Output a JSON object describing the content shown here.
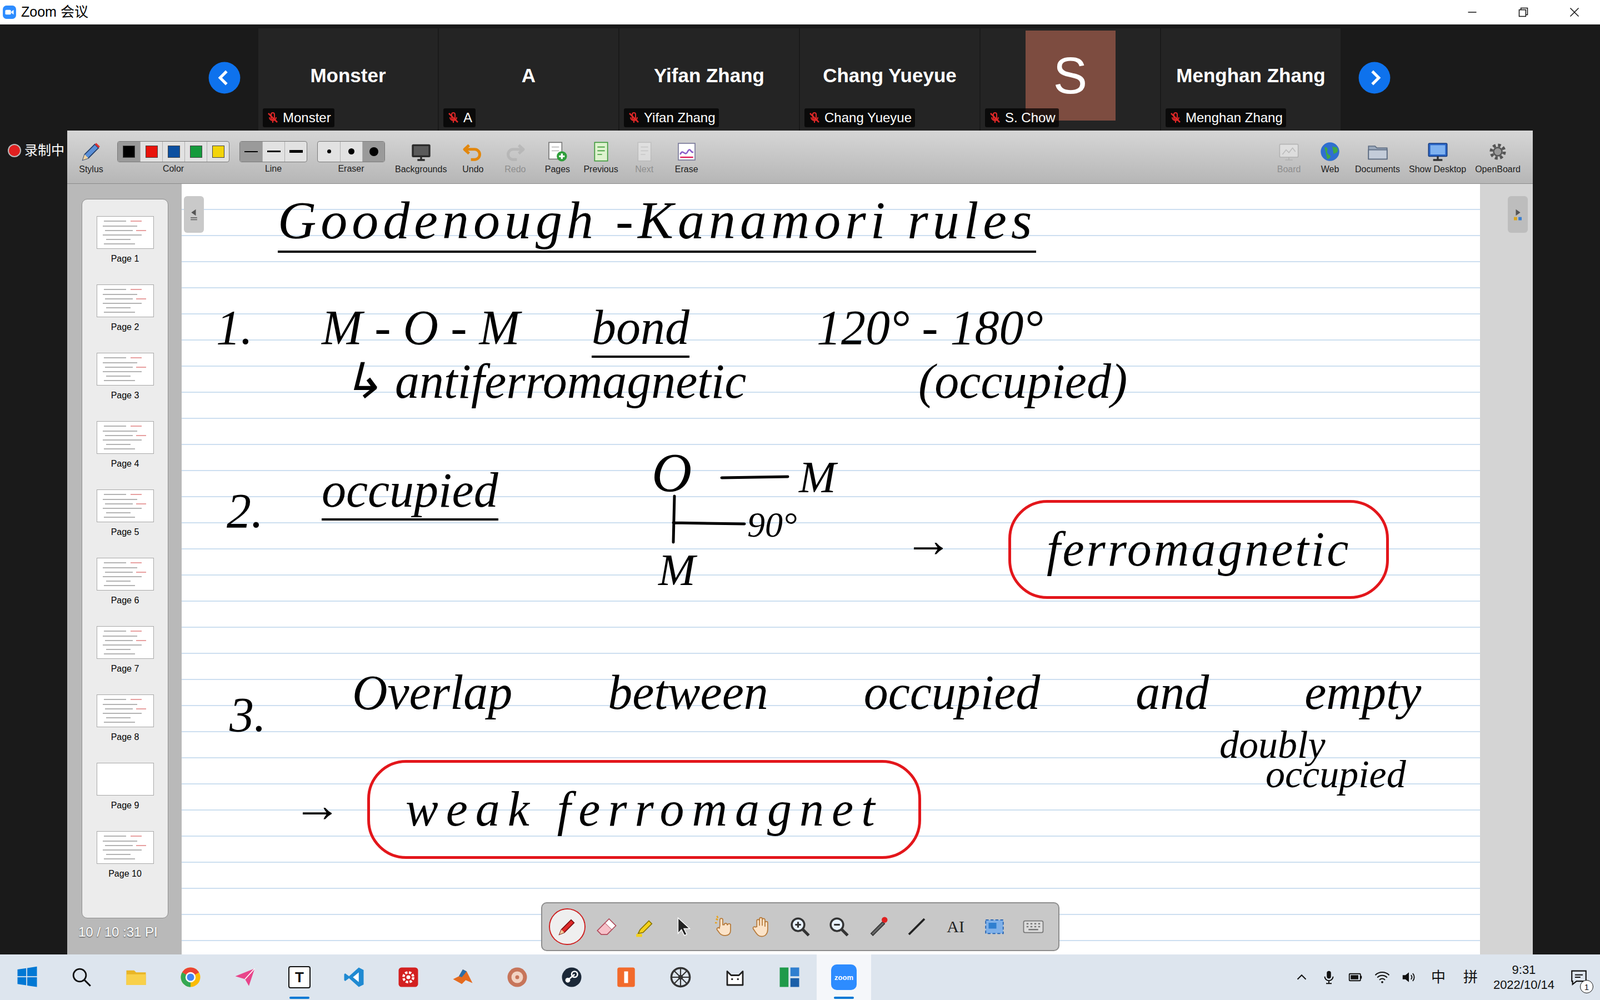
{
  "window": {
    "title": "Zoom 会议"
  },
  "recording": {
    "label": "录制中"
  },
  "participants": [
    {
      "name": "Monster",
      "label": "Monster",
      "muted": true,
      "kind": "name"
    },
    {
      "name": "A",
      "label": "A",
      "muted": true,
      "kind": "name"
    },
    {
      "name": "Yifan Zhang",
      "label": "Yifan Zhang",
      "muted": true,
      "kind": "name"
    },
    {
      "name": "Chang Yueyue",
      "label": "Chang Yueyue",
      "muted": true,
      "kind": "name"
    },
    {
      "name": "S",
      "label": "S. Chow",
      "muted": true,
      "kind": "avatar"
    },
    {
      "name": "Menghan Zhang",
      "label": "Menghan Zhang",
      "muted": true,
      "kind": "name"
    }
  ],
  "toolbar": {
    "left": [
      {
        "kind": "button",
        "label": "Stylus",
        "disabled": false
      },
      {
        "kind": "swatches",
        "label": "Color",
        "options": [
          {
            "color": "#000000",
            "selected": true
          },
          {
            "color": "#e8140c",
            "selected": false
          },
          {
            "color": "#0b4fa0",
            "selected": false
          },
          {
            "color": "#159a3c",
            "selected": false
          },
          {
            "color": "#f2d40b",
            "selected": false
          }
        ]
      },
      {
        "kind": "lines",
        "label": "Line",
        "options": [
          {
            "selected": true
          },
          {
            "selected": false
          },
          {
            "selected": false
          }
        ]
      },
      {
        "kind": "sizes",
        "label": "Eraser",
        "options": [
          {
            "selected": false
          },
          {
            "selected": false
          },
          {
            "selected": true
          }
        ]
      },
      {
        "kind": "button",
        "label": "Backgrounds",
        "disabled": false
      },
      {
        "kind": "button",
        "label": "Undo",
        "disabled": false
      },
      {
        "kind": "button",
        "label": "Redo",
        "disabled": true
      },
      {
        "kind": "button",
        "label": "Pages",
        "disabled": false
      },
      {
        "kind": "button",
        "label": "Previous",
        "disabled": false
      },
      {
        "kind": "button",
        "label": "Next",
        "disabled": true
      },
      {
        "kind": "button",
        "label": "Erase",
        "disabled": false
      }
    ],
    "right": [
      {
        "label": "Board",
        "disabled": true
      },
      {
        "label": "Web",
        "disabled": false
      },
      {
        "label": "Documents",
        "disabled": false
      },
      {
        "label": "Show Desktop",
        "disabled": false
      },
      {
        "label": "OpenBoard",
        "disabled": false
      }
    ]
  },
  "pages": {
    "items": [
      {
        "label": "Page 1",
        "blank": false,
        "selected": false
      },
      {
        "label": "Page 2",
        "blank": false,
        "selected": false
      },
      {
        "label": "Page 3",
        "blank": false,
        "selected": false
      },
      {
        "label": "Page 4",
        "blank": false,
        "selected": false
      },
      {
        "label": "Page 5",
        "blank": false,
        "selected": false
      },
      {
        "label": "Page 6",
        "blank": false,
        "selected": false
      },
      {
        "label": "Page 7",
        "blank": false,
        "selected": false
      },
      {
        "label": "Page 8",
        "blank": false,
        "selected": false
      },
      {
        "label": "Page 9",
        "blank": true,
        "selected": false
      },
      {
        "label": "Page 10",
        "blank": false,
        "selected": false
      }
    ],
    "counter": "10 / 10 :31 PI"
  },
  "canvas": {
    "notes": [
      {
        "text": "Goodenough -Kanamori rules",
        "kind": "underlined"
      },
      {
        "text": "1.",
        "kind": "plain"
      },
      {
        "text": "M - O - M",
        "kind": "plain"
      },
      {
        "text": "bond",
        "kind": "underlined"
      },
      {
        "text": "120° - 180°",
        "kind": "plain"
      },
      {
        "text": "↳ antiferromagnetic",
        "kind": "plain"
      },
      {
        "text": "(occupied)",
        "kind": "plain"
      },
      {
        "text": "2.",
        "kind": "plain"
      },
      {
        "text": "occupied",
        "kind": "underlined"
      },
      {
        "text": "O",
        "kind": "plain"
      },
      {
        "text": "M",
        "kind": "plain"
      },
      {
        "text": "90°",
        "kind": "small"
      },
      {
        "text": "M",
        "kind": "plain"
      },
      {
        "text": "→",
        "kind": "plain"
      },
      {
        "text": "ferromagnetic",
        "kind": "boxed"
      },
      {
        "text": "3.",
        "kind": "plain"
      },
      {
        "text": "Overlap between occupied and empty",
        "kind": "plain"
      },
      {
        "text": "doubly",
        "kind": "small"
      },
      {
        "text": "occupied",
        "kind": "small"
      },
      {
        "text": "→",
        "kind": "plain"
      },
      {
        "text": "weak ferromagnet",
        "kind": "boxed"
      }
    ]
  },
  "tools": [
    {
      "kind": "pen",
      "selected": true
    },
    {
      "kind": "eraser",
      "selected": false
    },
    {
      "kind": "marker",
      "selected": false
    },
    {
      "kind": "pointer",
      "selected": false
    },
    {
      "kind": "tap",
      "selected": false
    },
    {
      "kind": "hand",
      "selected": false
    },
    {
      "kind": "zoomin",
      "selected": false
    },
    {
      "kind": "zoomout",
      "selected": false
    },
    {
      "kind": "laser",
      "selected": false
    },
    {
      "kind": "line",
      "selected": false
    },
    {
      "kind": "text",
      "glyph": "AI",
      "selected": false
    },
    {
      "kind": "capture",
      "selected": false
    },
    {
      "kind": "keyboard",
      "selected": false
    }
  ],
  "taskbar": {
    "apps": [
      {
        "kind": "start",
        "selected": false,
        "running": false
      },
      {
        "kind": "search",
        "selected": false,
        "running": false
      },
      {
        "kind": "explorer",
        "selected": false,
        "running": false
      },
      {
        "kind": "chrome",
        "selected": false,
        "running": false
      },
      {
        "kind": "send",
        "selected": false,
        "running": false
      },
      {
        "kind": "typora",
        "glyph": "T",
        "selected": false,
        "running": true
      },
      {
        "kind": "vscode",
        "selected": false,
        "running": false
      },
      {
        "kind": "gear",
        "selected": false,
        "running": false
      },
      {
        "kind": "matlab",
        "selected": false,
        "running": false
      },
      {
        "kind": "disk",
        "selected": false,
        "running": false
      },
      {
        "kind": "steam",
        "selected": false,
        "running": false
      },
      {
        "kind": "notes",
        "selected": false,
        "running": false
      },
      {
        "kind": "wheel",
        "selected": false,
        "running": false
      },
      {
        "kind": "cat",
        "selected": false,
        "running": false
      },
      {
        "kind": "tiles",
        "selected": false,
        "running": false
      },
      {
        "kind": "zoom",
        "glyph": "zoom",
        "selected": true,
        "running": true
      }
    ],
    "ime": [
      "中",
      "拼"
    ],
    "time": "9:31",
    "date": "2022/10/14",
    "notifications": "1"
  }
}
